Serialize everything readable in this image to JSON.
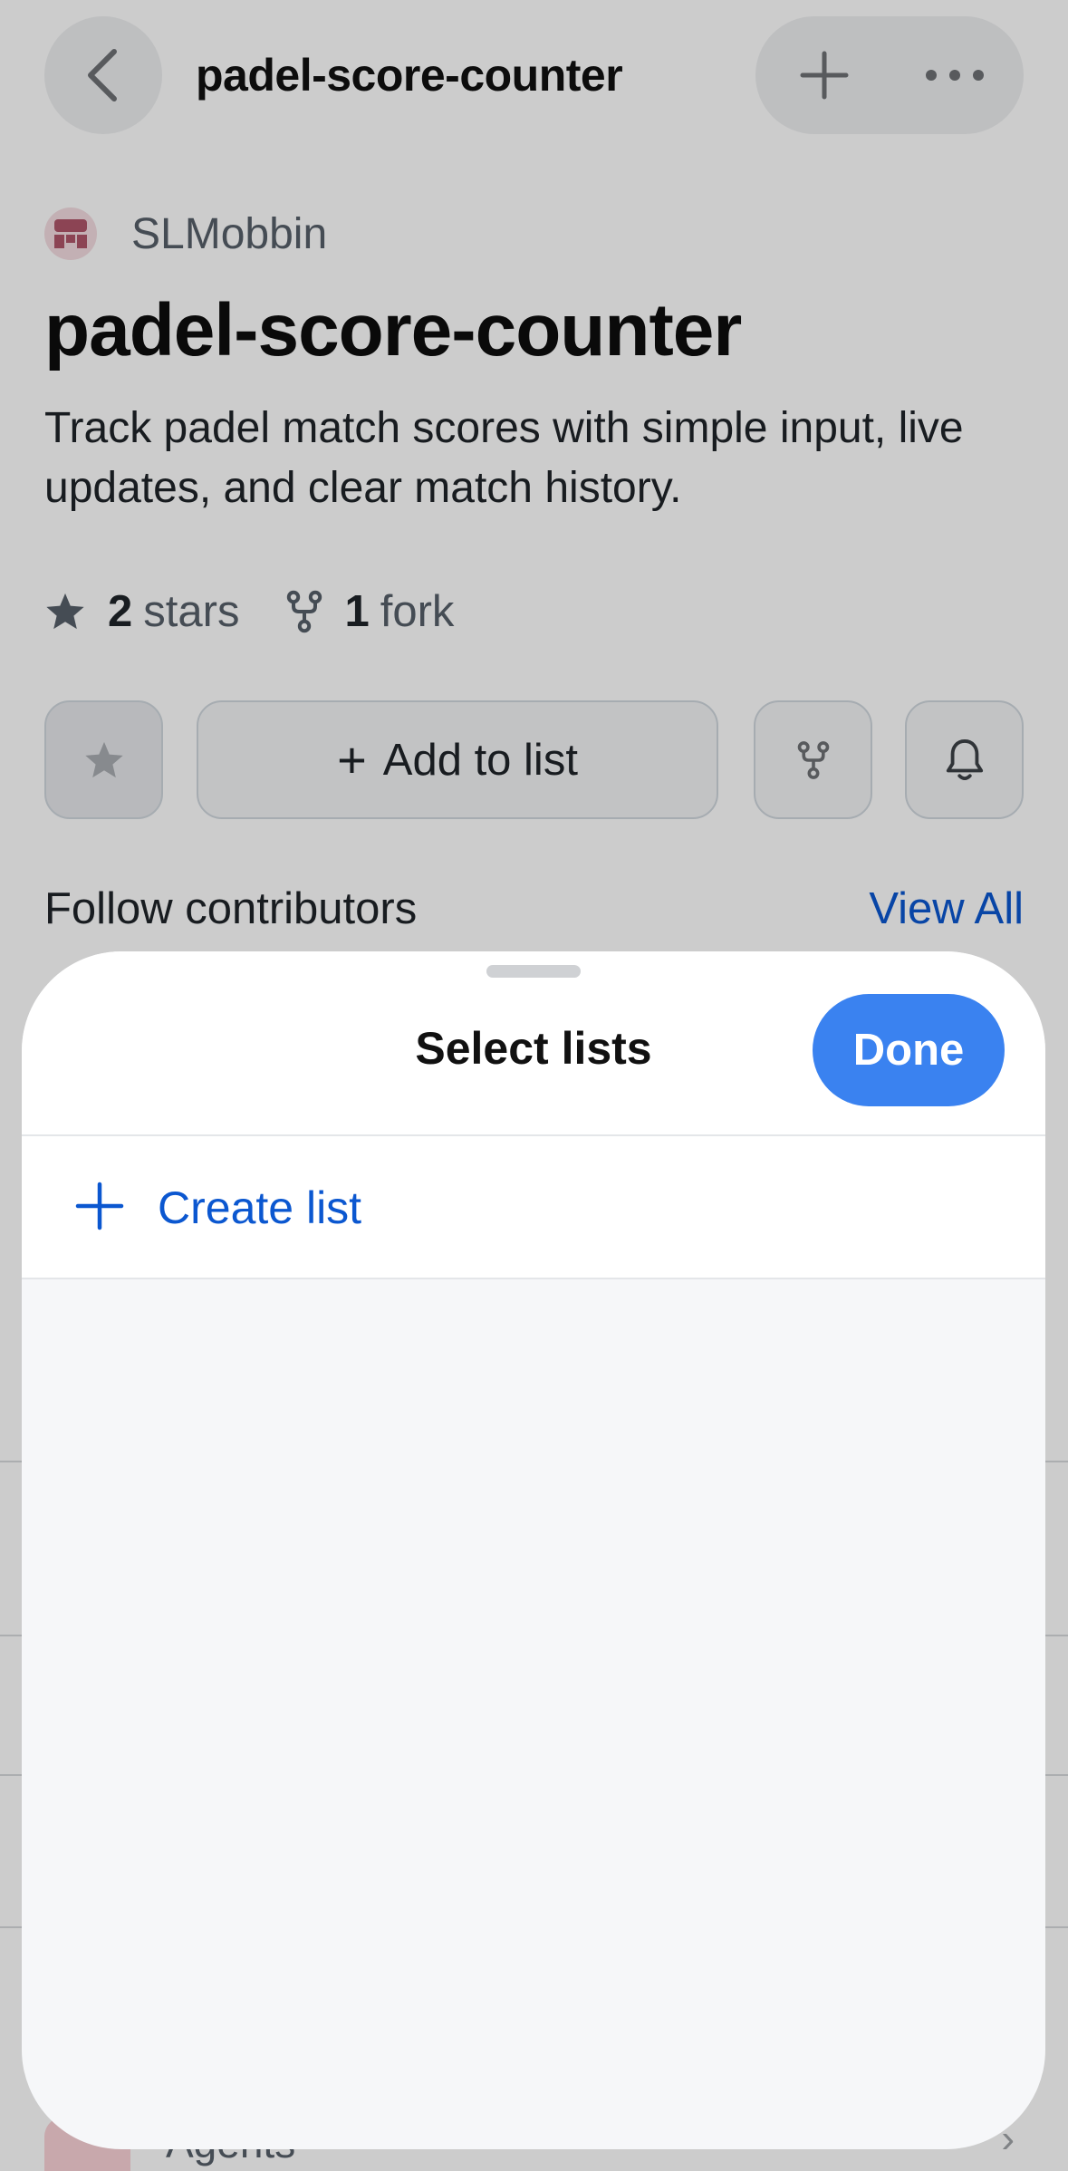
{
  "nav": {
    "title": "padel-score-counter",
    "back_icon": "chevron-left-icon",
    "add_icon": "plus-icon",
    "more_icon": "ellipsis-icon"
  },
  "repo": {
    "owner": "SLMobbin",
    "name": "padel-score-counter",
    "description": "Track padel match scores with simple input, live updates, and clear match history.",
    "stars_count": "2",
    "stars_label": "stars",
    "forks_count": "1",
    "forks_label": "fork"
  },
  "actions": {
    "add_to_list_label": "Add to list",
    "add_to_list_plus": "+"
  },
  "contributors": {
    "title": "Follow contributors",
    "view_all": "View All"
  },
  "background_rows": {
    "agents_label": "Agents",
    "agents_chevron": "›"
  },
  "sheet": {
    "title": "Select lists",
    "done_label": "Done",
    "create_list_label": "Create list"
  },
  "colors": {
    "accent": "#3a82f0",
    "link": "#0b57d0",
    "overlay": "rgba(0,0,0,0.20)"
  }
}
